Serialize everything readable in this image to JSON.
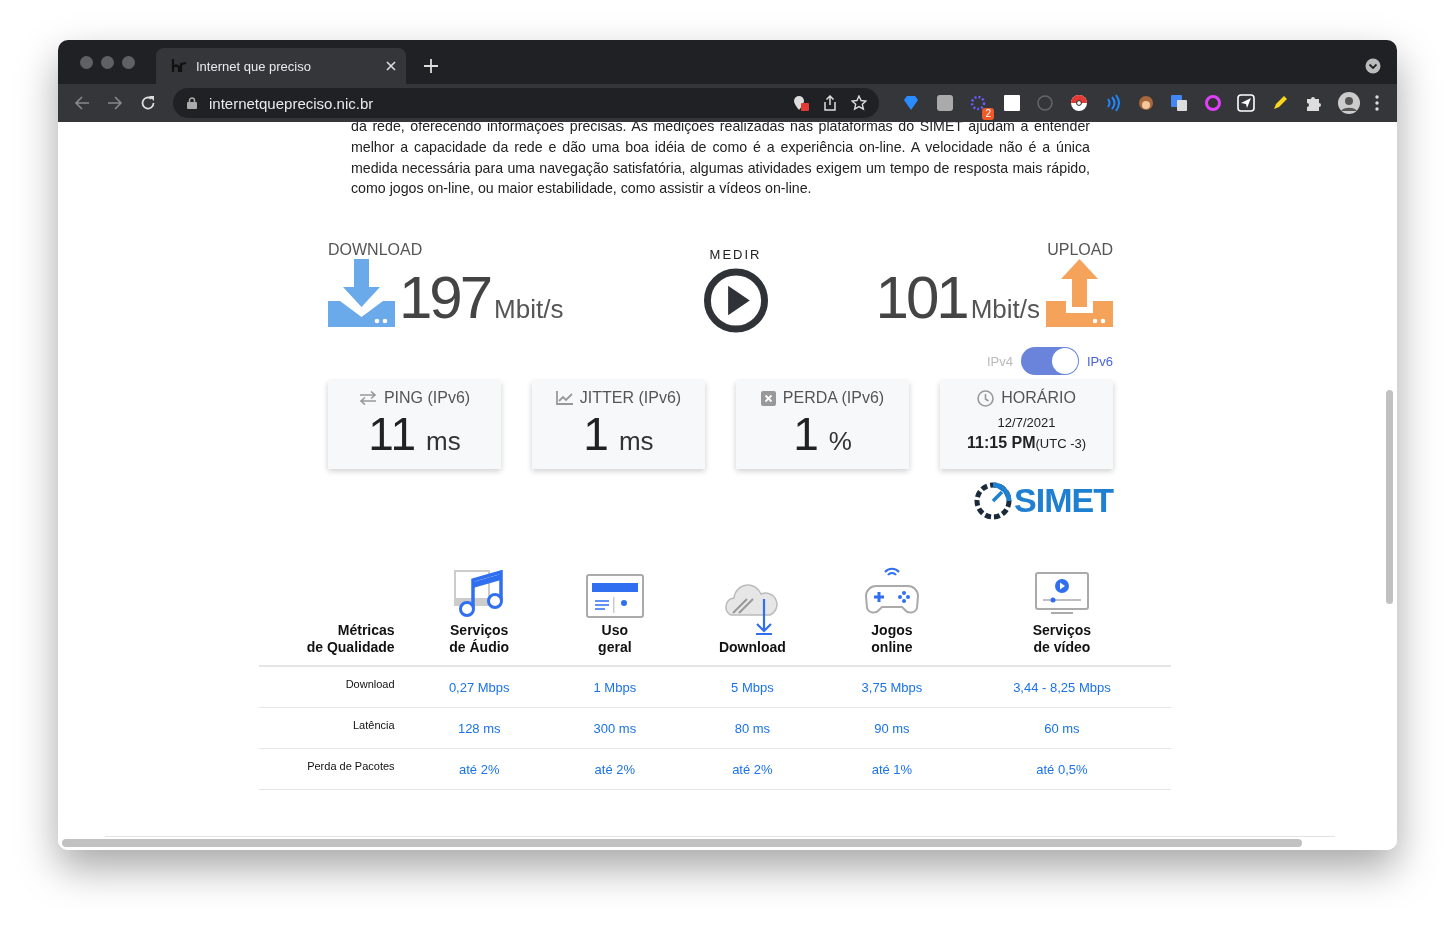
{
  "browser": {
    "tab_title": "Internet que preciso",
    "url": "internetquepreciso.nic.br",
    "extension_badge": "2"
  },
  "intro": "da rede, oferecendo informações precisas. As medições realizadas nas plataformas do SIMET ajudam a entender melhor a capacidade da rede e dão uma boa idéia de como é a experiência on-line. A velocidade não é a única medida necessária para uma navegação satisfatória, algumas atividades exigem um tempo de resposta mais rápido, como jogos on-line, ou maior estabilidade, como assistir a vídeos on-line.",
  "speed": {
    "download": {
      "label": "DOWNLOAD",
      "value": "197",
      "unit": "Mbit/s"
    },
    "measure_label": "MEDIR",
    "upload": {
      "label": "UPLOAD",
      "value": "101",
      "unit": "Mbit/s"
    }
  },
  "protocol_toggle": {
    "left_label": "IPv4",
    "right_label": "IPv6",
    "on": true
  },
  "cards": [
    {
      "kind": "ping",
      "title": "PING (IPv6)",
      "value": "11",
      "unit": "ms"
    },
    {
      "kind": "jitter",
      "title": "JITTER (IPv6)",
      "value": "1",
      "unit": "ms"
    },
    {
      "kind": "loss",
      "title": "PERDA (IPv6)",
      "value": "1",
      "unit": "%"
    },
    {
      "kind": "time",
      "title": "HORÁRIO",
      "date": "12/7/2021",
      "time": "11:15 PM",
      "zone": "(UTC -3)"
    }
  ],
  "logo_text": "SIMET",
  "quality_table": {
    "corner": "Métricas\nde Qualidade",
    "columns": [
      {
        "kind": "audio",
        "title": "Serviços\nde Áudio"
      },
      {
        "kind": "general",
        "title": "Uso\ngeral"
      },
      {
        "kind": "download",
        "title": "Download"
      },
      {
        "kind": "games",
        "title": "Jogos\nonline"
      },
      {
        "kind": "video",
        "title": "Serviços\nde vídeo"
      }
    ],
    "rows": [
      {
        "label": "Download",
        "values": [
          "0,27 Mbps",
          "1 Mbps",
          "5 Mbps",
          "3,75 Mbps",
          "3,44 - 8,25 Mbps"
        ]
      },
      {
        "label": "Latência",
        "values": [
          "128 ms",
          "300 ms",
          "80 ms",
          "90 ms",
          "60 ms"
        ]
      },
      {
        "label": "Perda de Pacotes",
        "values": [
          "até 2%",
          "até 2%",
          "até 2%",
          "até 1%",
          "até 0,5%"
        ]
      }
    ]
  }
}
